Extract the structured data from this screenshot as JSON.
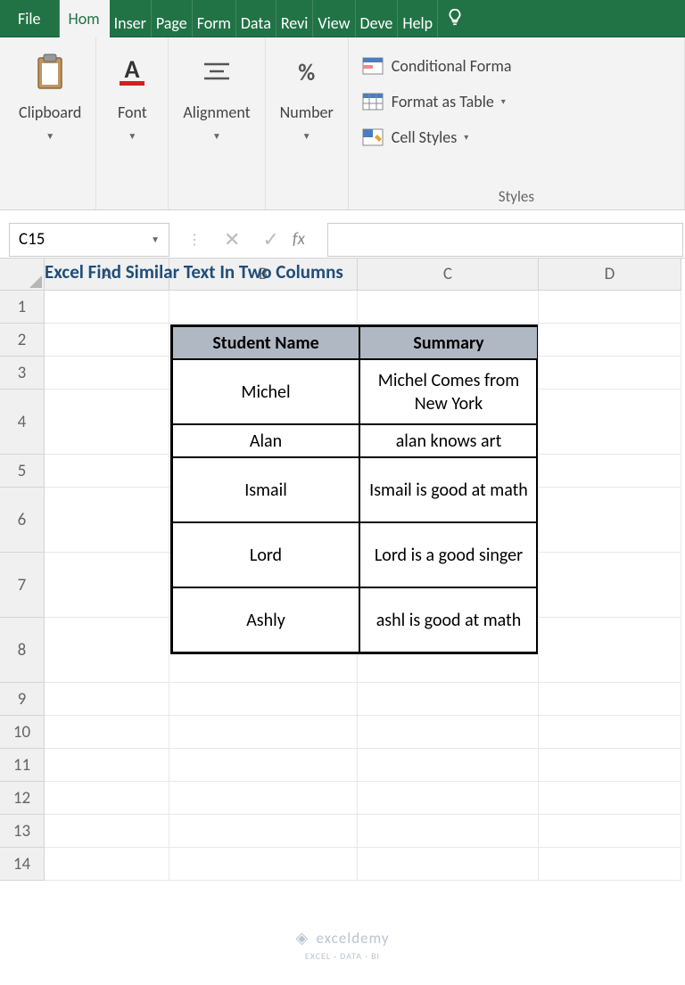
{
  "tabs": {
    "file": "File",
    "home": "Hom",
    "insert": "Inser",
    "page": "Page",
    "formulas": "Form",
    "data": "Data",
    "review": "Revi",
    "view": "View",
    "developer": "Deve",
    "help": "Help"
  },
  "ribbon": {
    "clipboard": "Clipboard",
    "font": "Font",
    "alignment": "Alignment",
    "number": "Number",
    "conditional": "Conditional Forma",
    "format_table": "Format as Table",
    "cell_styles": "Cell Styles",
    "styles": "Styles",
    "pct": "%"
  },
  "namebox": "C15",
  "fx": "fx",
  "columns": [
    "A",
    "B",
    "C",
    "D"
  ],
  "rows": [
    "1",
    "2",
    "3",
    "4",
    "5",
    "6",
    "7",
    "8",
    "9",
    "10",
    "11",
    "12",
    "13",
    "14"
  ],
  "title": "Excel Find Similar Text In Two Columns",
  "table": {
    "headers": [
      "Student Name",
      "Summary"
    ],
    "data": [
      [
        "Michel",
        "Michel Comes from New York"
      ],
      [
        "Alan",
        "alan knows art"
      ],
      [
        "Ismail",
        "Ismail is good at math"
      ],
      [
        "Lord",
        "Lord is a good singer"
      ],
      [
        "Ashly",
        "ashl is good at math"
      ]
    ]
  },
  "watermark": {
    "brand": "exceldemy",
    "tagline": "EXCEL · DATA · BI"
  }
}
